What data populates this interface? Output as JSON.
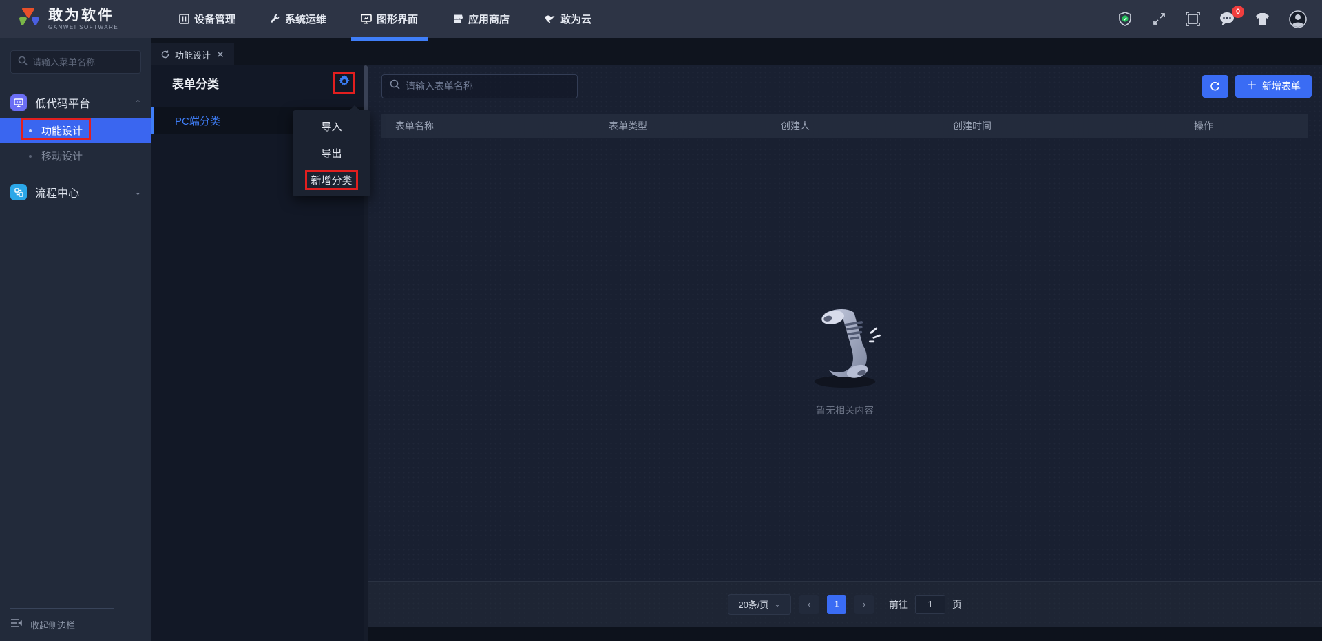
{
  "colors": {
    "accent": "#3a6cf4",
    "link_blue": "#3f7ef8",
    "annotation_red": "#e21f1f",
    "badge_red": "#f03e3e",
    "success_green": "#26bf5c"
  },
  "navbar": {
    "logo_title": "敢为软件",
    "logo_subtitle": "GANWEI  SOFTWARE",
    "items": [
      {
        "label": "设备管理"
      },
      {
        "label": "系统运维"
      },
      {
        "label": "图形界面"
      },
      {
        "label": "应用商店"
      },
      {
        "label": "敢为云"
      }
    ],
    "message_badge_count": "0"
  },
  "sidebar": {
    "search_placeholder": "请输入菜单名称",
    "groups": [
      {
        "label": "低代码平台",
        "expanded": true,
        "children": [
          {
            "label": "功能设计"
          },
          {
            "label": "移动设计"
          }
        ]
      },
      {
        "label": "流程中心",
        "expanded": false,
        "children": []
      }
    ],
    "collapse_label": "收起侧边栏"
  },
  "tabs": [
    {
      "label": "功能设计"
    }
  ],
  "category_panel": {
    "title": "表单分类",
    "items": [
      {
        "label": "PC端分类"
      }
    ],
    "menu": {
      "items": [
        "导入",
        "导出",
        "新增分类"
      ]
    }
  },
  "main": {
    "search_placeholder": "请输入表单名称",
    "add_button_label": "新增表单",
    "table": {
      "columns": [
        "表单名称",
        "表单类型",
        "创建人",
        "创建时间",
        "操作"
      ],
      "rows": []
    },
    "empty_text": "暂无相关内容",
    "pagination": {
      "page_size_label": "20条/页",
      "prev": "‹",
      "next": "›",
      "current_page": "1",
      "goto_label": "前往",
      "goto_value": "1",
      "page_unit": "页"
    }
  }
}
